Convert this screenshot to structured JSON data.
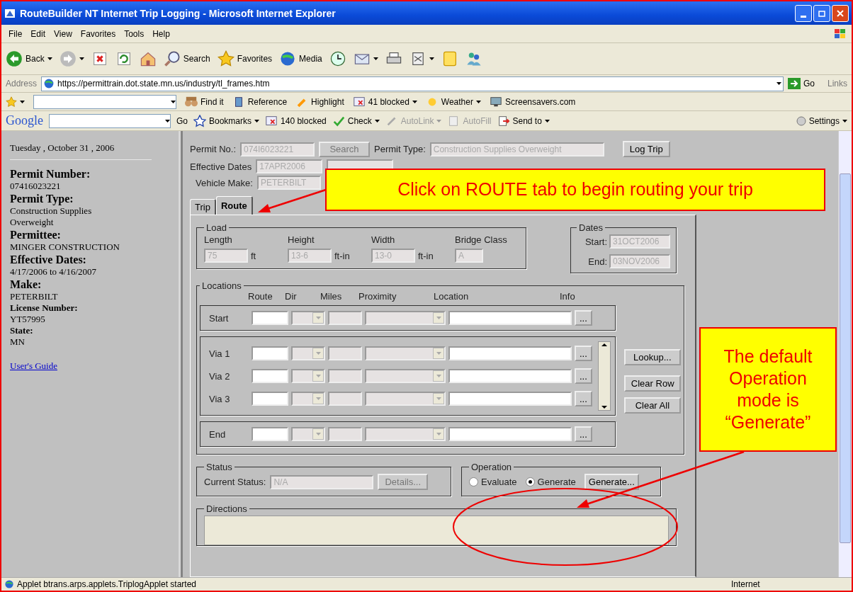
{
  "window": {
    "title": "RouteBuilder NT Internet Trip Logging - Microsoft Internet Explorer"
  },
  "menu": [
    "File",
    "Edit",
    "View",
    "Favorites",
    "Tools",
    "Help"
  ],
  "toolbar": [
    {
      "kind": "back",
      "label": "Back",
      "dropdown": true
    },
    {
      "kind": "forward",
      "dropdown": true
    },
    {
      "kind": "stop",
      "dropdown": false
    },
    {
      "kind": "refresh",
      "dropdown": false
    },
    {
      "kind": "home",
      "dropdown": false
    },
    {
      "kind": "search",
      "label": "Search",
      "dropdown": false
    },
    {
      "kind": "favorites",
      "label": "Favorites",
      "dropdown": false
    },
    {
      "kind": "media",
      "label": "Media",
      "dropdown": false
    },
    {
      "kind": "history",
      "dropdown": false
    },
    {
      "kind": "mail",
      "dropdown": true
    },
    {
      "kind": "print",
      "dropdown": false
    },
    {
      "kind": "edit",
      "dropdown": true
    },
    {
      "kind": "note",
      "dropdown": false
    },
    {
      "kind": "messenger",
      "dropdown": false
    }
  ],
  "address": {
    "label": "Address",
    "url": "https://permittrain.dot.state.mn.us/industry/tl_frames.htm",
    "go": "Go",
    "links": "Links"
  },
  "links_bar": [
    {
      "kind": "find",
      "label": "Find it",
      "dropdown": false
    },
    {
      "kind": "reference",
      "label": "Reference",
      "dropdown": false
    },
    {
      "kind": "highlight",
      "label": "Highlight",
      "dropdown": false
    },
    {
      "kind": "blocked",
      "label": "41 blocked",
      "dropdown": true
    },
    {
      "kind": "weather",
      "label": "Weather",
      "dropdown": true
    },
    {
      "kind": "screensaver",
      "label": "Screensavers.com",
      "dropdown": false
    }
  ],
  "google_bar": {
    "logo": "Google",
    "go": "Go",
    "items": [
      {
        "kind": "bookmarks",
        "label": "Bookmarks",
        "dropdown": true,
        "disabled": false
      },
      {
        "kind": "blocked",
        "label": "140 blocked",
        "dropdown": false,
        "disabled": false
      },
      {
        "kind": "check",
        "label": "Check",
        "dropdown": true,
        "disabled": false
      },
      {
        "kind": "autolink",
        "label": "AutoLink",
        "dropdown": true,
        "disabled": true
      },
      {
        "kind": "autofill",
        "label": "AutoFill",
        "dropdown": false,
        "disabled": true
      },
      {
        "kind": "sendto",
        "label": "Send to",
        "dropdown": true,
        "disabled": false
      }
    ],
    "settings": "Settings"
  },
  "sidebar": {
    "date": "Tuesday , October 31 , 2006",
    "fields": [
      {
        "label": "Permit Number:",
        "kind": "heading",
        "values": [
          "07416023221"
        ]
      },
      {
        "label": "Permit Type:",
        "kind": "heading",
        "values": [
          "Construction Supplies",
          "Overweight"
        ]
      },
      {
        "label": "Permittee:",
        "kind": "heading",
        "values": [
          "MINGER CONSTRUCTION"
        ]
      },
      {
        "label": "Effective Dates:",
        "kind": "heading",
        "values": [
          "4/17/2006 to 4/16/2007"
        ]
      },
      {
        "label": "Make:",
        "kind": "heading",
        "values": [
          "PETERBILT"
        ]
      },
      {
        "label": "License Number:",
        "kind": "bold",
        "values": [
          "YT57995"
        ]
      },
      {
        "label": "State:",
        "kind": "bold",
        "values": [
          "MN"
        ]
      }
    ],
    "link": "User's Guide"
  },
  "form": {
    "permit_no_label": "Permit No.:",
    "permit_no": "074I6023221",
    "search": "Search",
    "permit_type_label": "Permit Type:",
    "permit_type": "Construction Supplies Overweight",
    "log_trip": "Log Trip",
    "effective_label": "Effective Dates",
    "effective_start": "17APR2006",
    "make_label": "Vehicle Make:",
    "make": "PETERBILT"
  },
  "tabs": [
    {
      "label": "Trip",
      "selected": false
    },
    {
      "label": "Route",
      "selected": true
    }
  ],
  "load": {
    "title": "Load",
    "fields": [
      {
        "label": "Length",
        "value": "75",
        "unit": "ft"
      },
      {
        "label": "Height",
        "value": "13-6",
        "unit": "ft-in"
      },
      {
        "label": "Width",
        "value": "13-0",
        "unit": "ft-in"
      },
      {
        "label": "Bridge Class",
        "value": "A"
      }
    ]
  },
  "dates": {
    "title": "Dates",
    "start_label": "Start:",
    "start": "31OCT2006",
    "end_label": "End:",
    "end": "03NOV2006"
  },
  "locations": {
    "title": "Locations",
    "columns": [
      "Route",
      "Dir",
      "Miles",
      "Proximity",
      "Location",
      "Info"
    ],
    "groups": [
      {
        "kind": "single",
        "rows": [
          "Start"
        ]
      },
      {
        "kind": "scroll",
        "rows": [
          "Via 1",
          "Via 2",
          "Via 3"
        ]
      },
      {
        "kind": "single",
        "rows": [
          "End"
        ]
      }
    ],
    "info_button": "...",
    "buttons": [
      "Lookup...",
      "Clear Row",
      "Clear All"
    ]
  },
  "status": {
    "title": "Status",
    "label": "Current Status:",
    "value": "N/A",
    "details": "Details..."
  },
  "operation": {
    "title": "Operation",
    "options": [
      {
        "label": "Evaluate",
        "selected": false
      },
      {
        "label": "Generate",
        "selected": true
      }
    ],
    "button": "Generate..."
  },
  "directions": {
    "title": "Directions"
  },
  "status_bar": {
    "text": "Applet btrans.arps.applets.TriplogApplet started",
    "zone": "Internet"
  },
  "annotations": [
    {
      "text": "Click on ROUTE tab to begin routing your trip"
    },
    {
      "text": "The default Operation mode is “Generate”"
    }
  ]
}
